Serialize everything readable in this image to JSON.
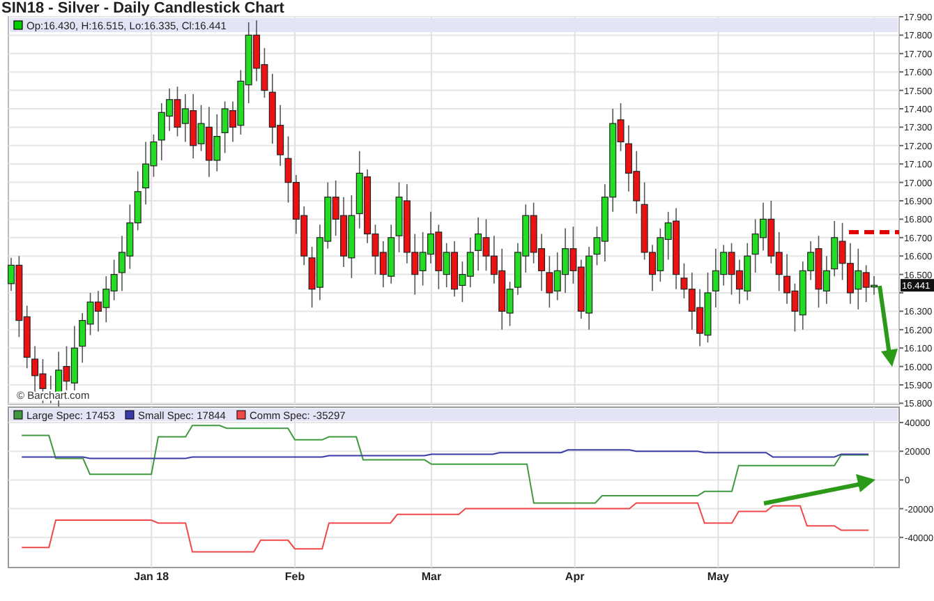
{
  "title": "SIN18 - Silver - Daily Candlestick Chart",
  "price_chart": {
    "legend": "Op:16.430, H:16.515, Lo:16.335, Cl:16.441",
    "y_ticks": [
      "17.900",
      "17.800",
      "17.700",
      "17.600",
      "17.500",
      "17.400",
      "17.300",
      "17.200",
      "17.100",
      "17.000",
      "16.900",
      "16.800",
      "16.700",
      "16.600",
      "16.500"
    ],
    "last_price": "16.441",
    "y_ticks_below": [
      "16.300",
      "16.200",
      "16.100",
      "16.000",
      "15.900",
      "15.800"
    ],
    "credit": "© Barchart.com"
  },
  "cot_chart": {
    "chart_data": {
      "type": "line",
      "grid": true,
      "legend": "top",
      "categories": [
        null,
        null,
        null,
        null,
        null,
        null,
        null,
        null,
        null,
        null,
        null,
        null,
        null,
        null,
        null,
        null,
        null,
        null,
        null,
        "Jan 18",
        null,
        null,
        null,
        null,
        null,
        null,
        null,
        null,
        null,
        null,
        null,
        null,
        null,
        null,
        null,
        null,
        null,
        null,
        null,
        null,
        "Feb",
        null,
        null,
        null,
        null,
        null,
        null,
        null,
        null,
        null,
        null,
        null,
        null,
        null,
        null,
        null,
        null,
        null,
        null,
        null,
        "Mar",
        null,
        null,
        null,
        null,
        null,
        null,
        null,
        null,
        null,
        null,
        null,
        null,
        null,
        null,
        null,
        null,
        null,
        null,
        null,
        null,
        "Apr",
        null,
        null,
        null,
        null,
        null,
        null,
        null,
        null,
        null,
        null,
        null,
        null,
        null,
        null,
        null,
        null,
        null,
        null,
        null,
        null,
        "May",
        null,
        null,
        null,
        null,
        null,
        null,
        null,
        null,
        null,
        null,
        null,
        null,
        null,
        null,
        null,
        null,
        null,
        null,
        null,
        null,
        null,
        null
      ],
      "series": [
        {
          "name": "Large Spec: 17453",
          "color": "#3f9a3f",
          "values": [
            31000,
            31000,
            31000,
            31000,
            31000,
            15000,
            15000,
            15000,
            15000,
            15000,
            4000,
            4000,
            4000,
            4000,
            4000,
            4000,
            4000,
            4000,
            4000,
            4000,
            30000,
            30000,
            30000,
            30000,
            30000,
            38000,
            38000,
            38000,
            38000,
            38000,
            36000,
            36000,
            36000,
            36000,
            36000,
            36000,
            36000,
            36000,
            36000,
            36000,
            28000,
            28000,
            28000,
            28000,
            28000,
            30000,
            30000,
            30000,
            30000,
            30000,
            14000,
            14000,
            14000,
            14000,
            14000,
            14000,
            14000,
            14000,
            14000,
            14000,
            11000,
            11000,
            11000,
            11000,
            11000,
            11000,
            11000,
            11000,
            11000,
            11000,
            11000,
            11000,
            11000,
            11000,
            11000,
            -16000,
            -16000,
            -16000,
            -16000,
            -16000,
            -16000,
            -16000,
            -16000,
            -16000,
            -16000,
            -11000,
            -11000,
            -11000,
            -11000,
            -11000,
            -11000,
            -11000,
            -11000,
            -11000,
            -11000,
            -11000,
            -11000,
            -11000,
            -11000,
            -11000,
            -8000,
            -8000,
            -8000,
            -8000,
            -8000,
            10000,
            10000,
            10000,
            10000,
            10000,
            10000,
            10000,
            10000,
            10000,
            10000,
            10000,
            10000,
            10000,
            10000,
            10000,
            17500,
            17500,
            17500,
            17500,
            17500
          ]
        },
        {
          "name": "Small Spec: 17844",
          "color": "#3a3aa8",
          "values": [
            16000,
            16000,
            16000,
            16000,
            16000,
            16000,
            16000,
            16000,
            16000,
            16000,
            15000,
            15000,
            15000,
            15000,
            15000,
            15000,
            15000,
            15000,
            15000,
            15000,
            15000,
            15000,
            15000,
            15000,
            15000,
            16000,
            16000,
            16000,
            16000,
            16000,
            16000,
            16000,
            16000,
            16000,
            16000,
            16000,
            16000,
            16000,
            16000,
            16000,
            16000,
            16000,
            16000,
            16000,
            16000,
            17000,
            17000,
            17000,
            17000,
            17000,
            17000,
            17000,
            17000,
            17000,
            17000,
            17000,
            17000,
            17000,
            17000,
            17000,
            18000,
            18000,
            18000,
            18000,
            18000,
            18000,
            18000,
            18000,
            18000,
            18000,
            19000,
            19000,
            19000,
            19000,
            19000,
            19000,
            19000,
            19000,
            19000,
            19000,
            21000,
            21000,
            21000,
            21000,
            21000,
            21000,
            21000,
            21000,
            21000,
            21000,
            20000,
            20000,
            20000,
            20000,
            20000,
            20000,
            20000,
            20000,
            20000,
            20000,
            19000,
            19000,
            19000,
            19000,
            19000,
            19000,
            19000,
            19000,
            19000,
            19000,
            16000,
            16000,
            16000,
            16000,
            16000,
            16000,
            16000,
            16000,
            16000,
            16000,
            18000,
            18000,
            18000,
            18000,
            18000
          ]
        },
        {
          "name": "Comm Spec: -35297",
          "color": "#f04848",
          "values": [
            -47000,
            -47000,
            -47000,
            -47000,
            -47000,
            -28000,
            -28000,
            -28000,
            -28000,
            -28000,
            -28000,
            -28000,
            -28000,
            -28000,
            -28000,
            -28000,
            -28000,
            -28000,
            -28000,
            -28000,
            -30000,
            -30000,
            -30000,
            -30000,
            -30000,
            -50000,
            -50000,
            -50000,
            -50000,
            -50000,
            -50000,
            -50000,
            -50000,
            -50000,
            -50000,
            -42000,
            -42000,
            -42000,
            -42000,
            -42000,
            -48000,
            -48000,
            -48000,
            -48000,
            -48000,
            -30000,
            -30000,
            -30000,
            -30000,
            -30000,
            -30000,
            -30000,
            -30000,
            -30000,
            -30000,
            -24000,
            -24000,
            -24000,
            -24000,
            -24000,
            -24000,
            -24000,
            -24000,
            -24000,
            -24000,
            -20000,
            -20000,
            -20000,
            -20000,
            -20000,
            -20000,
            -20000,
            -20000,
            -20000,
            -20000,
            -20000,
            -20000,
            -20000,
            -20000,
            -20000,
            -20000,
            -20000,
            -20000,
            -20000,
            -20000,
            -20000,
            -20000,
            -20000,
            -20000,
            -20000,
            -16000,
            -16000,
            -16000,
            -16000,
            -16000,
            -16000,
            -16000,
            -16000,
            -16000,
            -16000,
            -30000,
            -30000,
            -30000,
            -30000,
            -30000,
            -22000,
            -22000,
            -22000,
            -22000,
            -22000,
            -18000,
            -18000,
            -18000,
            -18000,
            -18000,
            -32000,
            -32000,
            -32000,
            -32000,
            -32000,
            -35000,
            -35000,
            -35000,
            -35000,
            -35000
          ]
        }
      ],
      "ylim": [
        -61000,
        50700
      ],
      "yticks": [
        40000,
        20000,
        0,
        -20000,
        -40000
      ]
    }
  }
}
